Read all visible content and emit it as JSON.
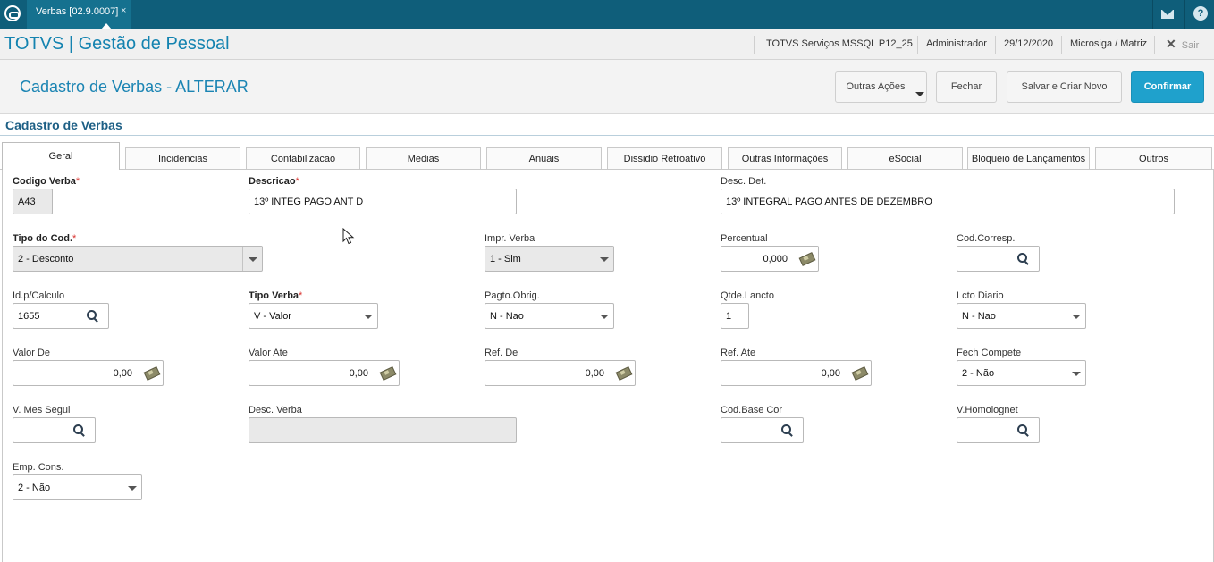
{
  "topbar": {
    "tab_label": "Verbas [02.9.0007]",
    "tab_close": "×",
    "mail_icon": "mail-icon",
    "help_icon": "help-icon",
    "help_glyph": "?"
  },
  "appbar": {
    "title": "TOTVS | Gestão de Pessoal",
    "environment": "TOTVS Serviços MSSQL P12_25",
    "user": "Administrador",
    "date": "29/12/2020",
    "company": "Microsiga / Matriz",
    "exit_label": "Sair",
    "exit_glyph": "✕"
  },
  "header": {
    "title": "Cadastro de Verbas - ALTERAR",
    "buttons": {
      "other_actions": "Outras Ações",
      "close": "Fechar",
      "save_new": "Salvar e Criar Novo",
      "confirm": "Confirmar"
    }
  },
  "section_title": "Cadastro de Verbas",
  "tabs": [
    {
      "label": "Geral",
      "active": true
    },
    {
      "label": "Incidencias"
    },
    {
      "label": "Contabilizacao"
    },
    {
      "label": "Medias"
    },
    {
      "label": "Anuais"
    },
    {
      "label": "Dissidio Retroativo"
    },
    {
      "label": "Outras Informações"
    },
    {
      "label": "eSocial"
    },
    {
      "label": "Bloqueio de Lançamentos"
    },
    {
      "label": "Outros"
    }
  ],
  "form": {
    "codigo_verba": {
      "label": "Codigo Verba",
      "value": "A43"
    },
    "descricao": {
      "label": "Descricao",
      "value": "13º INTEG PAGO ANT D"
    },
    "desc_det": {
      "label": "Desc. Det.",
      "value": "13º INTEGRAL PAGO ANTES DE DEZEMBRO"
    },
    "tipo_cod": {
      "label": "Tipo do Cod.",
      "value": "2 - Desconto"
    },
    "impr_verba": {
      "label": "Impr. Verba",
      "value": "1 - Sim"
    },
    "percentual": {
      "label": "Percentual",
      "value": "0,000"
    },
    "cod_corresp": {
      "label": "Cod.Corresp.",
      "value": ""
    },
    "id_calculo": {
      "label": "Id.p/Calculo",
      "value": "1655"
    },
    "tipo_verba": {
      "label": "Tipo Verba",
      "value": "V - Valor"
    },
    "pagto_obrig": {
      "label": "Pagto.Obrig.",
      "value": "N - Nao"
    },
    "qtde_lancto": {
      "label": "Qtde.Lancto",
      "value": "1"
    },
    "lcto_diario": {
      "label": "Lcto Diario",
      "value": "N - Nao"
    },
    "valor_de": {
      "label": "Valor De",
      "value": "0,00"
    },
    "valor_ate": {
      "label": "Valor Ate",
      "value": "0,00"
    },
    "ref_de": {
      "label": "Ref. De",
      "value": "0,00"
    },
    "ref_ate": {
      "label": "Ref. Ate",
      "value": "0,00"
    },
    "fech_compete": {
      "label": "Fech Compete",
      "value": "2 - Não"
    },
    "v_mes_segui": {
      "label": "V. Mes Segui",
      "value": ""
    },
    "desc_verba": {
      "label": "Desc. Verba",
      "value": ""
    },
    "cod_base_cor": {
      "label": "Cod.Base Cor",
      "value": ""
    },
    "v_homolognet": {
      "label": "V.Homolognet",
      "value": ""
    },
    "emp_cons": {
      "label": "Emp. Cons.",
      "value": "2 - Não"
    },
    "required_mark": "*"
  },
  "colors": {
    "topbar": "#0f5e7a",
    "accent": "#1a84b3",
    "primary_button": "#1fa1cc",
    "required": "#d9302c"
  }
}
